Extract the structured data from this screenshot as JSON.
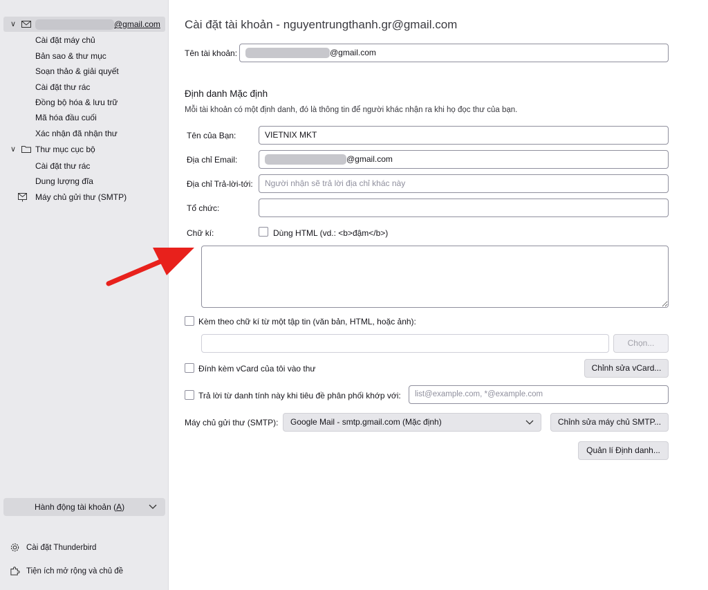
{
  "sidebar": {
    "account": {
      "email_prefix_masked": true,
      "email_suffix": "@gmail.com",
      "expand": "∨"
    },
    "account_items": [
      "Cài đặt máy chủ",
      "Bản sao & thư mục",
      "Soạn thảo & giải quyết",
      "Cài đặt thư rác",
      "Đồng bộ hóa & lưu trữ",
      "Mã hóa đầu cuối",
      "Xác nhận đã nhận thư"
    ],
    "local_folders": {
      "label": "Thư mục cục bộ",
      "expand": "∨"
    },
    "local_items": [
      "Cài đặt thư rác",
      "Dung lượng đĩa"
    ],
    "smtp_label": "Máy chủ gửi thư (SMTP)",
    "account_actions": {
      "label_main": "Hành động tài khoản (",
      "accesskey": "A",
      "label_end": ")"
    },
    "settings_link": "Cài đặt Thunderbird",
    "addons_link": "Tiện ích mở rộng và chủ đề"
  },
  "main": {
    "title": "Cài đặt tài khoản - nguyentrungthanh.gr@gmail.com",
    "account_name_label": "Tên tài khoản:",
    "account_name_suffix": "@gmail.com",
    "identity_heading": "Định danh Mặc định",
    "identity_desc": "Mỗi tài khoản có một định danh, đó là thông tin để người khác nhận ra khi họ đọc thư của bạn.",
    "your_name_label": "Tên của Bạn:",
    "your_name_value": "VIETNIX MKT",
    "email_label": "Địa chỉ Email:",
    "email_suffix": "@gmail.com",
    "reply_to_label": "Địa chỉ Trả-lời-tới:",
    "reply_to_placeholder": "Người nhận sẽ trả lời địa chỉ khác này",
    "org_label": "Tổ chức:",
    "org_value": "",
    "signature_label": "Chữ kí:",
    "use_html_label": "Dùng HTML (vd.: <b>đậm</b>)",
    "attach_sig_label": "Kèm theo chữ kí từ một tập tin (văn bản, HTML, hoặc ảnh):",
    "choose_button": "Chọn...",
    "vcard_label": "Đính kèm vCard của tôi vào thư",
    "edit_vcard_button": "Chỉnh sửa vCard...",
    "reply_identity_label": "Trả lời từ danh tính này khi tiêu đề phân phối khớp với:",
    "reply_identity_placeholder": "list@example.com, *@example.com",
    "smtp_label": "Máy chủ gửi thư (SMTP):",
    "smtp_selected": "Google Mail - smtp.gmail.com (Mặc định)",
    "edit_smtp_button": "Chỉnh sửa máy chủ SMTP...",
    "manage_identities_button": "Quản lí Định danh..."
  },
  "colors": {
    "arrow": "#e8211c",
    "sidebar_bg": "#eaeaed"
  }
}
